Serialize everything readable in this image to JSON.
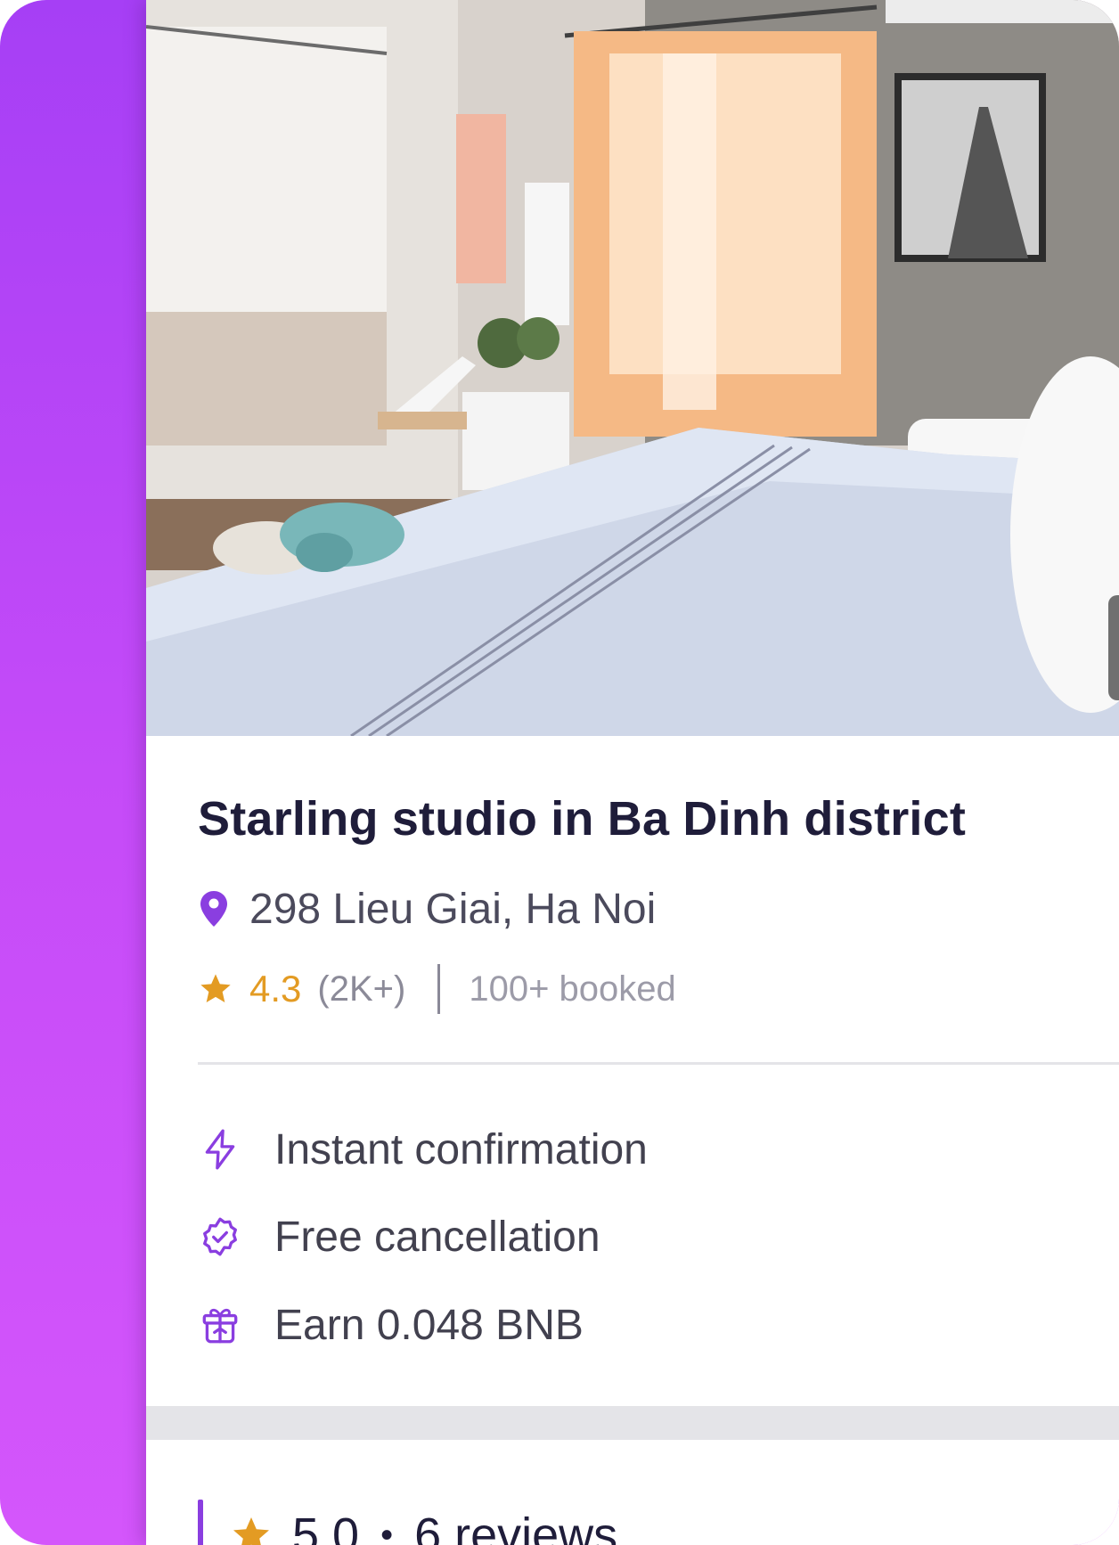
{
  "listing": {
    "title": "Starling studio in Ba Dinh district",
    "address": "298 Lieu Giai, Ha Noi",
    "rating": "4.3",
    "rating_count": "(2K+)",
    "booked": "100+ booked"
  },
  "features": [
    {
      "icon": "lightning-icon",
      "label": "Instant confirmation"
    },
    {
      "icon": "verified-badge-icon",
      "label": "Free cancellation"
    },
    {
      "icon": "gift-icon",
      "label": "Earn 0.048 BNB"
    }
  ],
  "reviews": {
    "score": "5.0",
    "separator": "•",
    "count_label": "6 reviews"
  },
  "colors": {
    "accent_purple": "#8a3ee0",
    "star_gold": "#e39b23",
    "title": "#1f1d3a",
    "gradient_start": "#a63ff5",
    "gradient_end": "#d456fb"
  }
}
